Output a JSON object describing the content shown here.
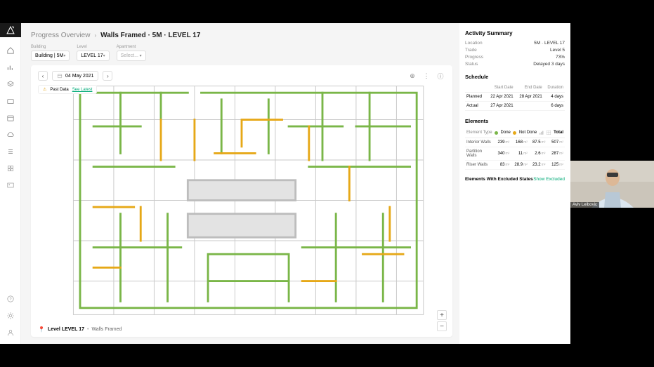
{
  "breadcrumb": {
    "root": "Progress Overview",
    "current": "Walls Framed · 5M · LEVEL 17"
  },
  "filters": {
    "building_label": "Building",
    "building_value": "Building | 5M",
    "level_label": "Level",
    "level_value": "LEVEL 17",
    "apartment_label": "Apartment",
    "apartment_value": "Select..."
  },
  "toolbar": {
    "date": "04 May 2021"
  },
  "past_data": {
    "label": "Past Data",
    "link": "See Latest"
  },
  "footer": {
    "level": "Level LEVEL 17",
    "sep": "•",
    "activity": "Walls Framed"
  },
  "summary": {
    "title": "Activity Summary",
    "location_k": "Location",
    "location_v": "5M · LEVEL 17",
    "trade_k": "Trade",
    "trade_v": "Level 5",
    "progress_k": "Progress",
    "progress_v": "73%",
    "status_k": "Status",
    "status_v": "Delayed 3 days"
  },
  "schedule": {
    "title": "Schedule",
    "headers": {
      "c0": "",
      "c1": "Start Date",
      "c2": "End Date",
      "c3": "Duration"
    },
    "rows": [
      {
        "label": "Planned",
        "start": "22 Apr 2021",
        "end": "28 Apr 2021",
        "dur": "4 days"
      },
      {
        "label": "Actual",
        "start": "27 Apr 2021",
        "end": "",
        "dur": "6 days"
      }
    ]
  },
  "elements": {
    "title": "Elements",
    "legend": {
      "type": "Element Type",
      "done": "Done",
      "notdone": "Not Done",
      "total": "Total"
    },
    "unit": "m²",
    "rows": [
      {
        "type": "Interior Walls",
        "done": "239",
        "notdone": "168",
        "pct": "87.5",
        "total": "507"
      },
      {
        "type": "Partition Walls",
        "done": "340",
        "notdone": "11",
        "pct": "2.6",
        "total": "287"
      },
      {
        "type": "Riser Walls",
        "done": "83",
        "notdone": "28.9",
        "pct": "23.2",
        "total": "125"
      }
    ]
  },
  "excluded": {
    "label": "Elements With Excluded States",
    "link": "Show Excluded"
  },
  "video": {
    "name": "Aviv Leibovic"
  }
}
